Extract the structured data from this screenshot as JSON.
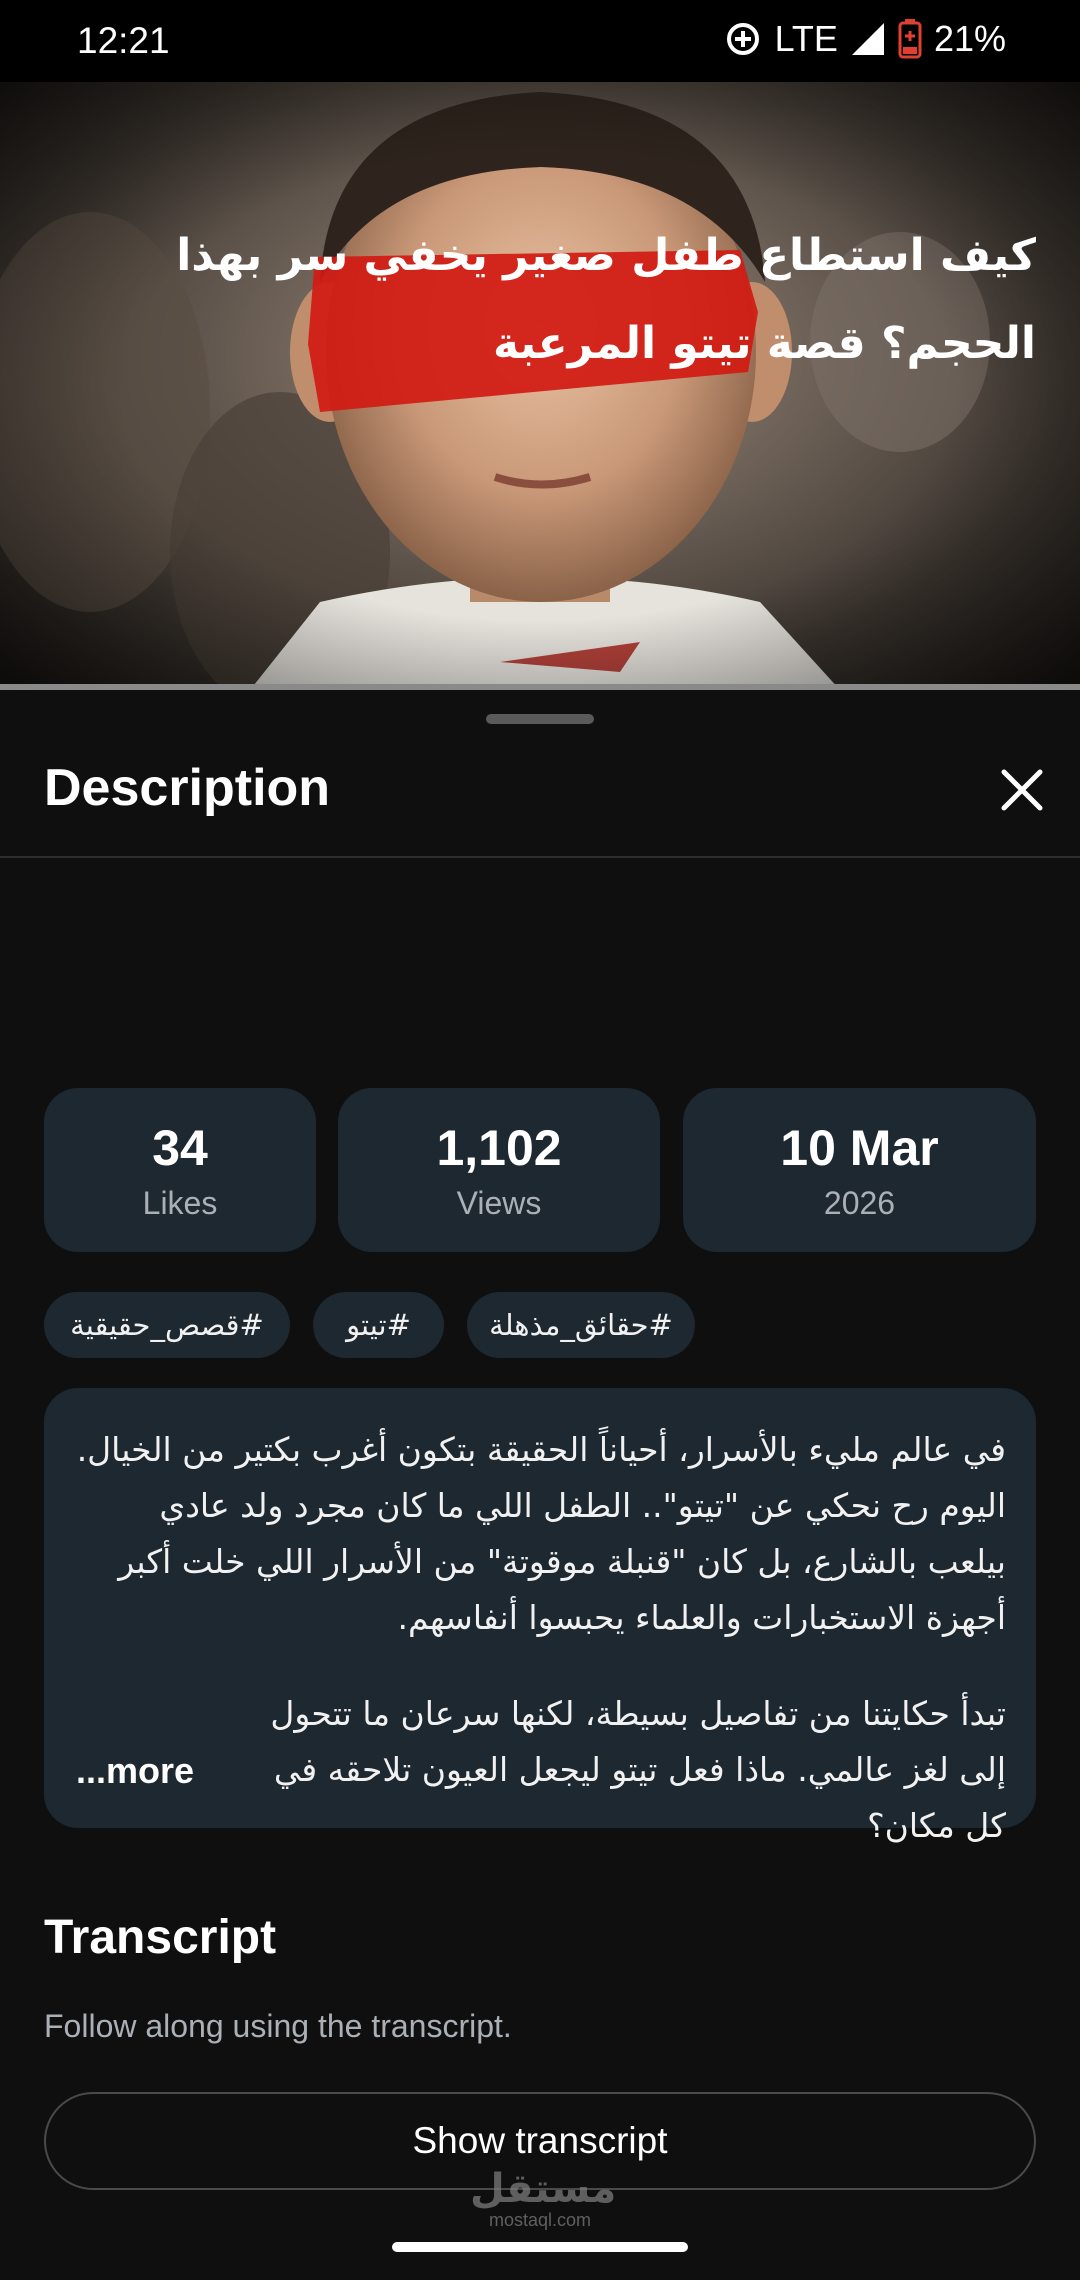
{
  "status_bar": {
    "time": "12:21",
    "network": "LTE",
    "battery": "21%",
    "icons": [
      "data-saver-icon",
      "signal-icon",
      "battery-icon"
    ]
  },
  "video": {
    "thumbnail": "boy-portrait-red-censor-bar-thumbnail"
  },
  "sheet": {
    "title": "Description",
    "close_icon": "close-icon"
  },
  "video_title": "كيف استطاع طفل صغير يخفي سر بهذا الحجم؟ قصة تيتو المرعبة",
  "stats": {
    "likes": {
      "value": "34",
      "label": "Likes"
    },
    "views": {
      "value": "1,102",
      "label": "Views"
    },
    "date": {
      "value": "10 Mar",
      "label": "2026"
    }
  },
  "hashtags": [
    "#قصص_حقيقية",
    "#تيتو",
    "#حقائق_مذهلة"
  ],
  "description": {
    "paragraph1": "في عالم مليء بالأسرار، أحياناً الحقيقة بتكون أغرب بكتير من الخيال. اليوم رح نحكي عن \"تيتو\".. الطفل اللي ما كان مجرد ولد عادي بيلعب بالشارع، بل كان \"قنبلة موقوتة\" من الأسرار اللي خلت أكبر أجهزة الاستخبارات والعلماء يحبسوا أنفاسهم.",
    "paragraph2": "تبدأ حكايتنا من تفاصيل بسيطة، لكنها سرعان ما تتحول إلى لغز عالمي. ماذا فعل تيتو ليجعل العيون تلاحقه في كل مكان؟",
    "more": "...more"
  },
  "transcript": {
    "title": "Transcript",
    "subtitle": "Follow along using the transcript.",
    "button": "Show transcript"
  },
  "watermark": {
    "arabic": "مستقل",
    "latin": "mostaql.com"
  },
  "colors": {
    "background": "#0f0f0f",
    "card": "#1e2831",
    "secondary_text": "#aab0b6",
    "accent_red": "#d11a12"
  }
}
